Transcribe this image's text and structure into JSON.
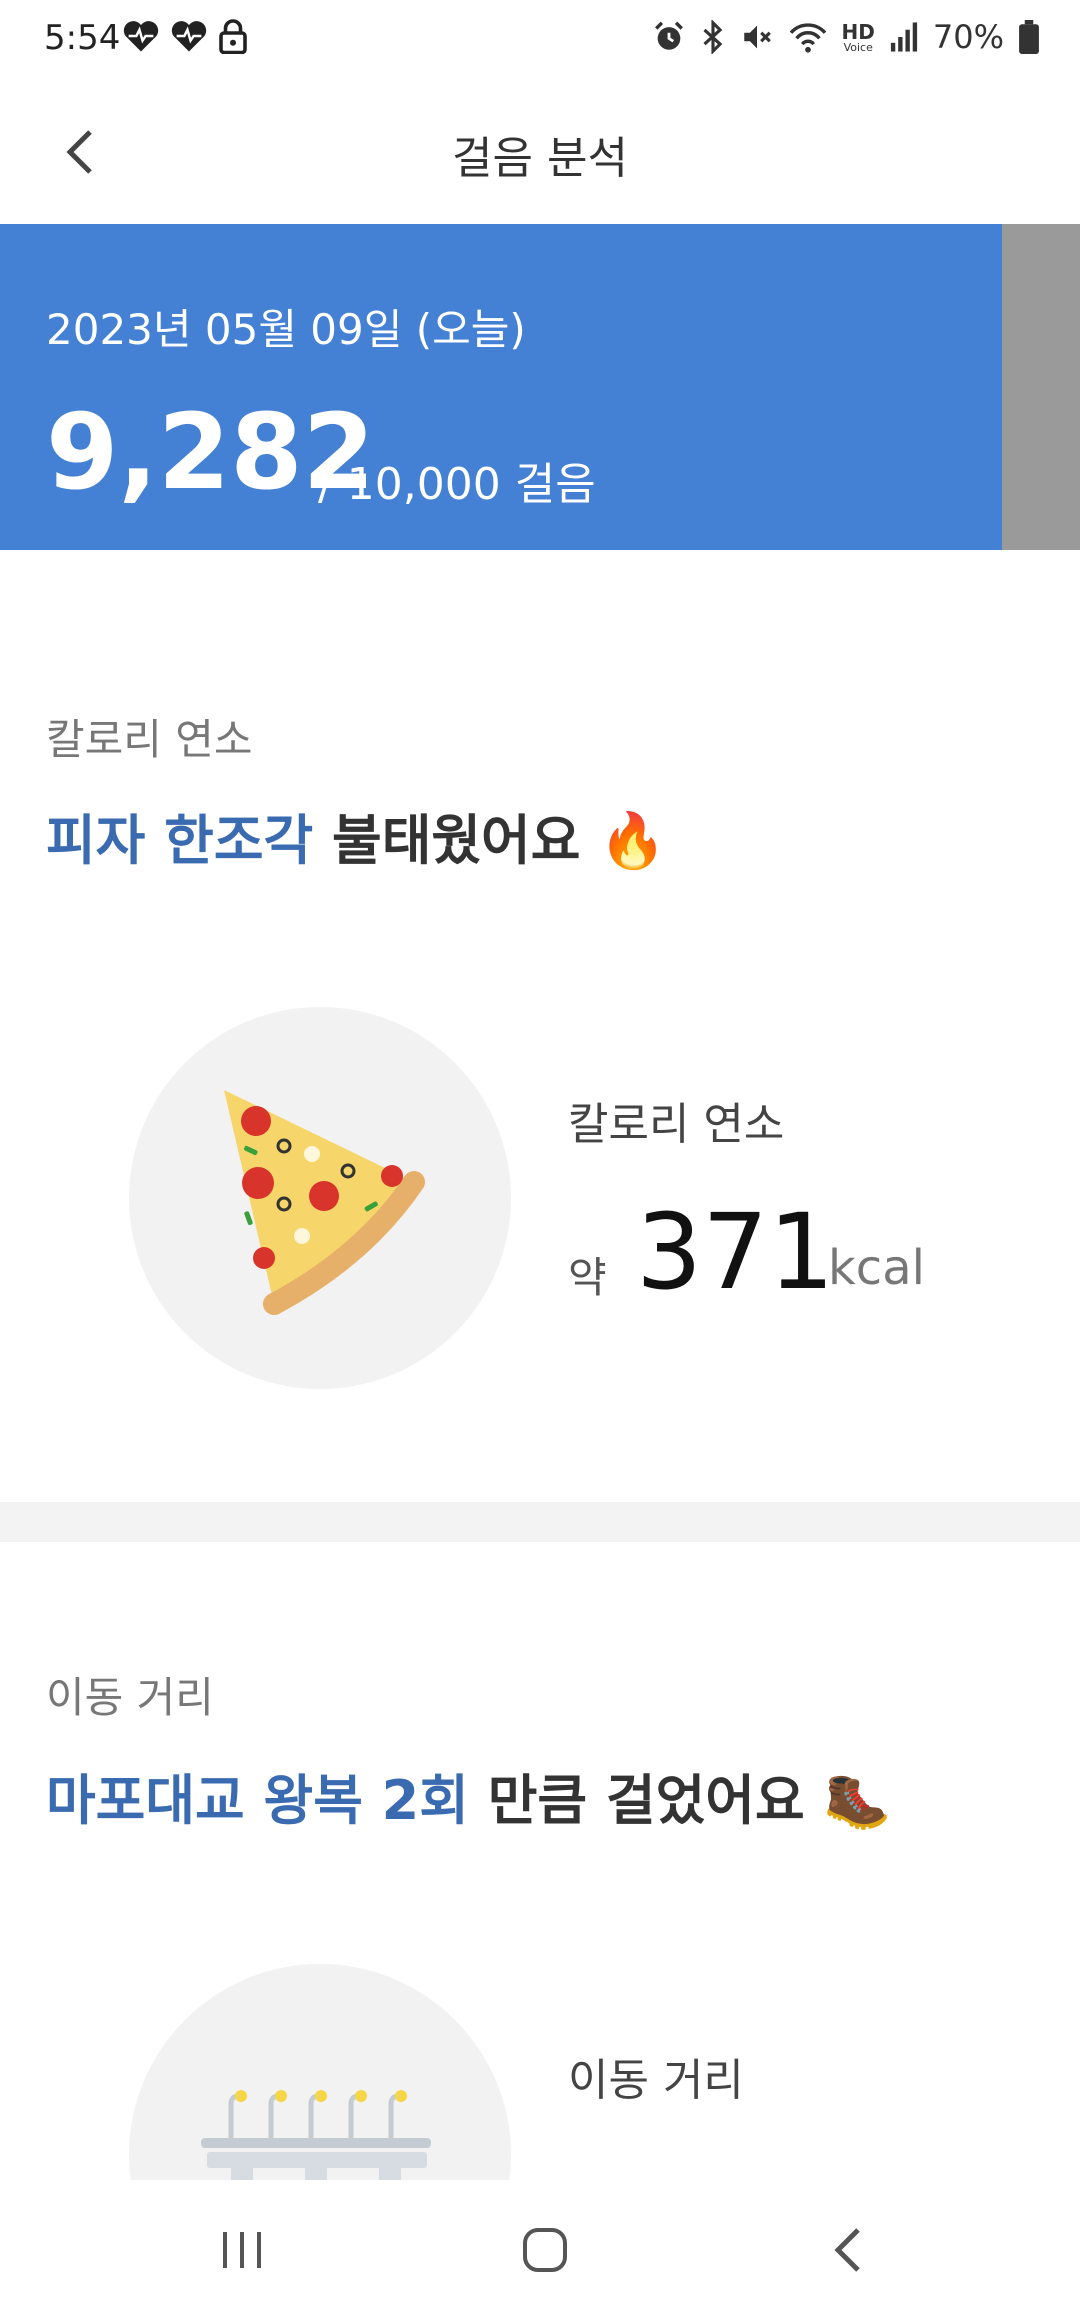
{
  "status_bar": {
    "time": "5:54",
    "battery": "70%",
    "left_icons": [
      "heart-icon",
      "heart-icon",
      "lock-icon"
    ],
    "right_icons": [
      "alarm-icon",
      "bluetooth-icon",
      "mute-icon",
      "wifi-icon",
      "hd-voice-icon",
      "signal-icon",
      "battery-icon"
    ],
    "hd_label": "HD",
    "voice_label": "Voice"
  },
  "header": {
    "title": "걸음 분석"
  },
  "banner": {
    "date": "2023년 05월 09일 (오늘)",
    "steps": "9,282",
    "goal": "/ 10,000 걸음",
    "color": "#4480d3"
  },
  "calories": {
    "section_label": "칼로리 연소",
    "headline_highlight": "피자 한조각",
    "headline_rest": "불태웠어요",
    "headline_emoji": "🔥",
    "stat_label": "칼로리 연소",
    "prefix": "약",
    "value": "371",
    "unit": "kcal"
  },
  "distance": {
    "section_label": "이동 거리",
    "headline_highlight": "마포대교 왕복 2회",
    "headline_rest": "만큼 걸었어요",
    "headline_emoji": "🥾",
    "stat_label": "이동 거리"
  },
  "colors": {
    "accent": "#3a6ab0",
    "banner": "#4480d3"
  }
}
